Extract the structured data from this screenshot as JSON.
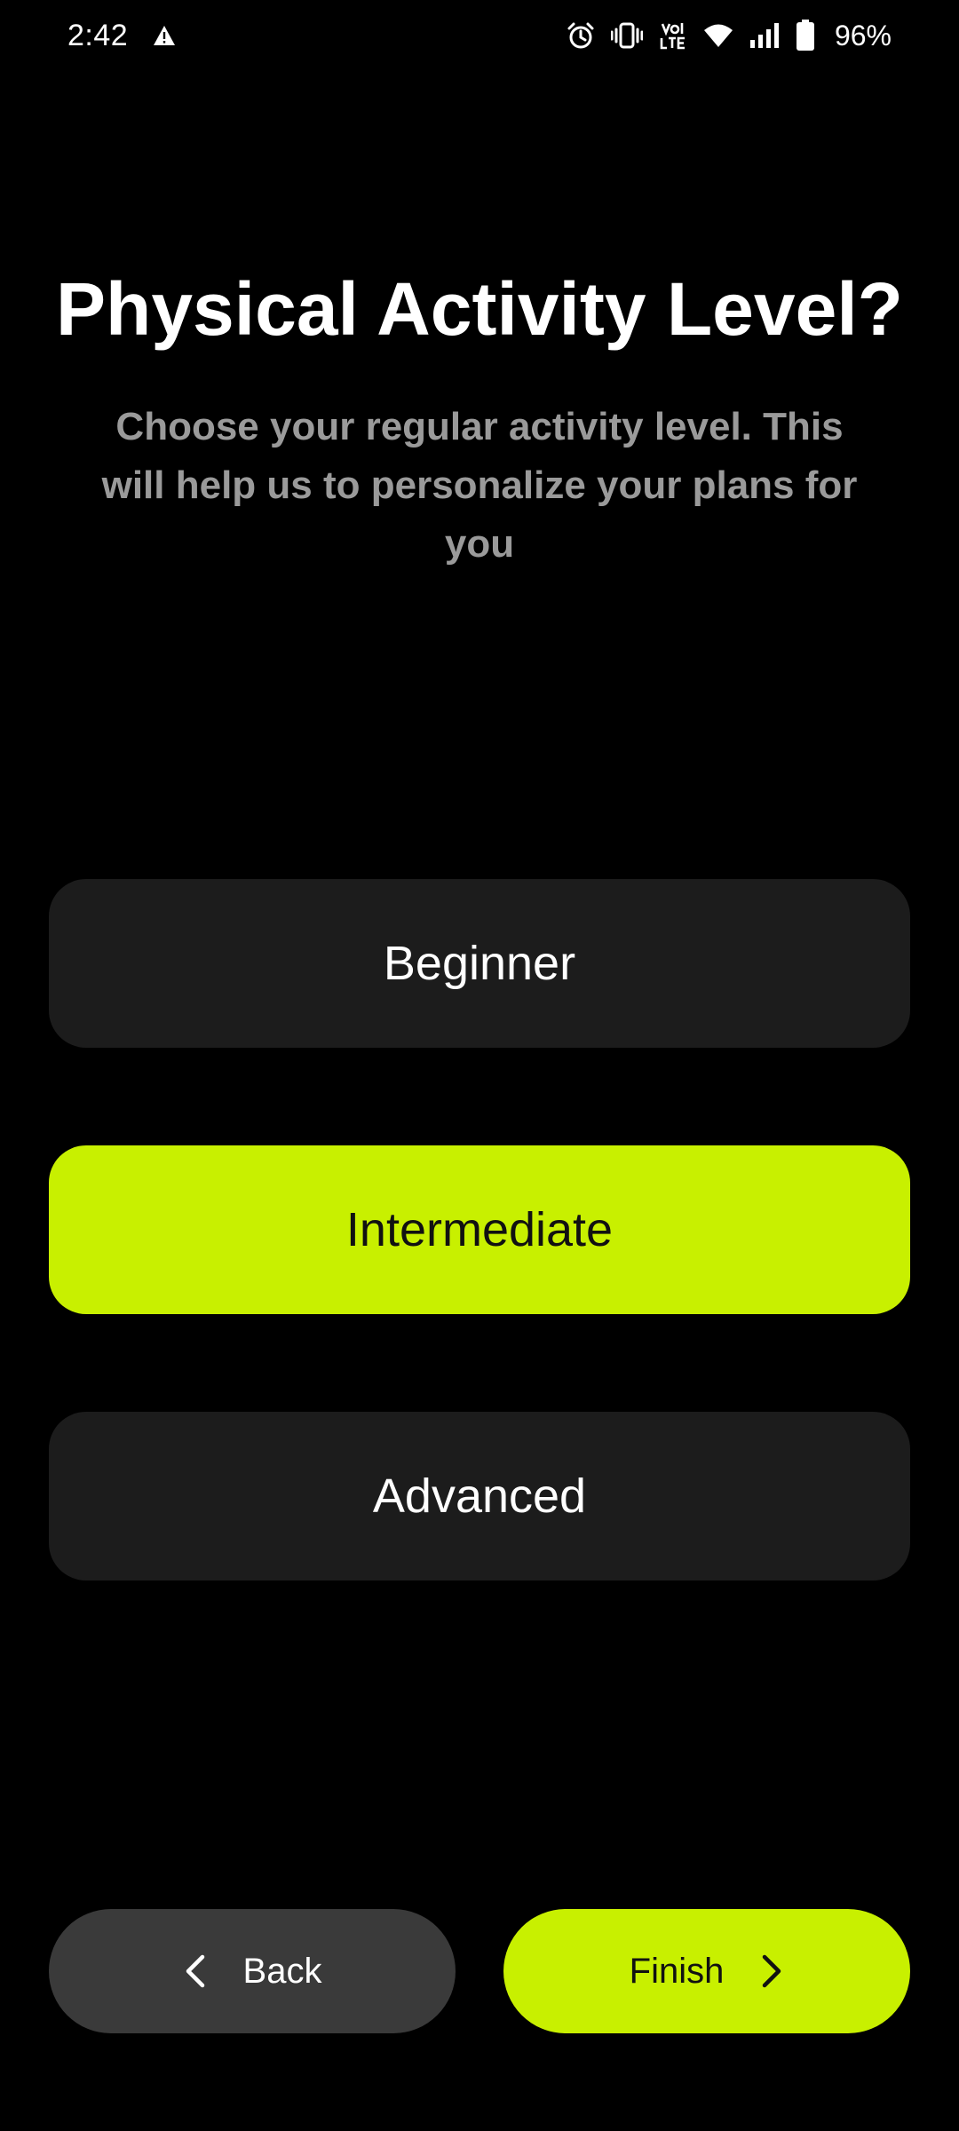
{
  "status_bar": {
    "time": "2:42",
    "battery": "96%",
    "icons": [
      "warning-icon",
      "alarm-icon",
      "vibrate-icon",
      "volte-icon",
      "wifi-icon",
      "signal-icon",
      "battery-icon"
    ]
  },
  "header": {
    "title": "Physical Activity Level?",
    "subtitle": "Choose your regular activity level. This will help us to personalize your plans for you"
  },
  "options": [
    {
      "label": "Beginner",
      "selected": false
    },
    {
      "label": "Intermediate",
      "selected": true
    },
    {
      "label": "Advanced",
      "selected": false
    }
  ],
  "footer": {
    "back_label": "Back",
    "finish_label": "Finish"
  },
  "colors": {
    "accent": "#c8f000",
    "background": "#000000",
    "card": "#1c1c1c",
    "secondary_button": "#3a3a3a",
    "subtitle": "#9a9a9a"
  }
}
